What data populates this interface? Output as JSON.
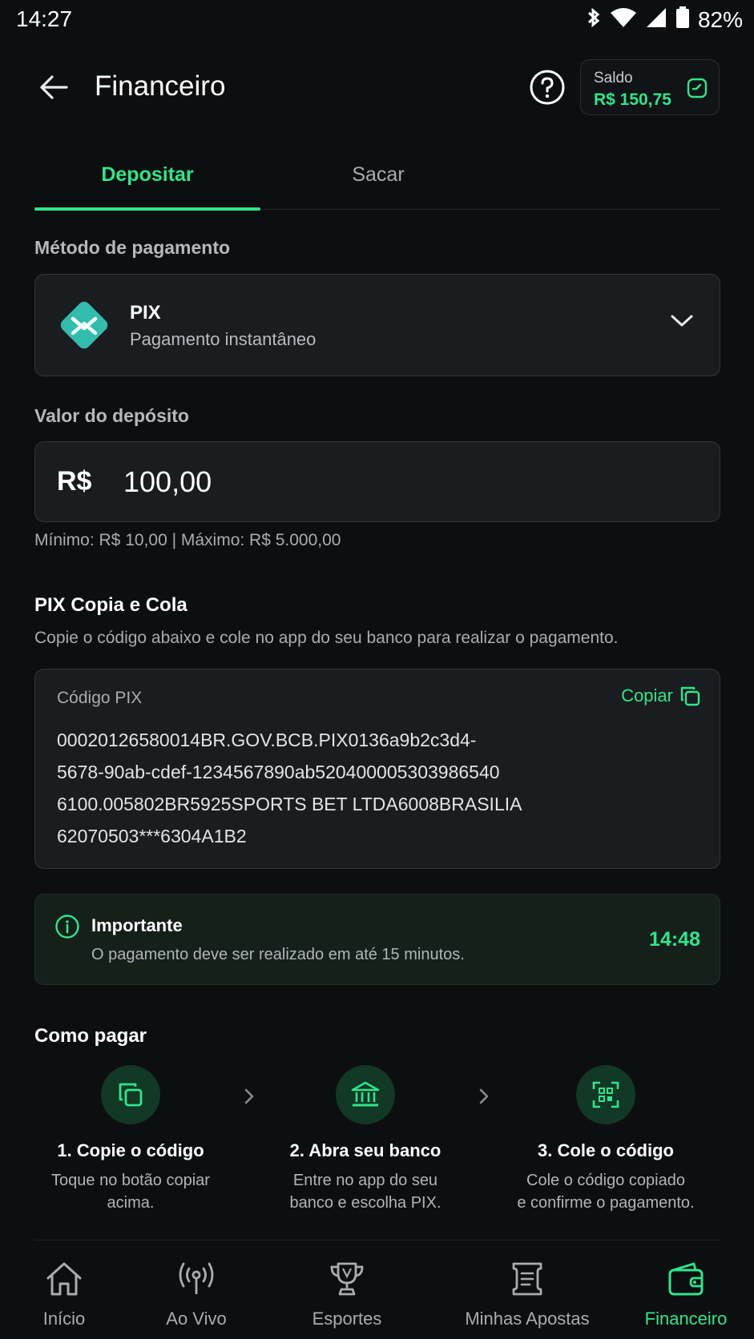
{
  "status_bar": {
    "time": "14:27",
    "battery": "82%"
  },
  "header": {
    "title": "Financeiro",
    "balance_label": "Saldo",
    "balance_value": "R$ 150,75"
  },
  "tabs": [
    {
      "label": "Depositar",
      "active": true
    },
    {
      "label": "Sacar",
      "active": false
    }
  ],
  "payment_method": {
    "section_label": "Método de pagamento",
    "name": "PIX",
    "description": "Pagamento instantâneo"
  },
  "deposit": {
    "section_label": "Valor do depósito",
    "currency": "R$",
    "value": "100,00",
    "limits": "Mínimo: R$ 10,00 | Máximo: R$ 5.000,00"
  },
  "pix_copy": {
    "title": "PIX Copia e Cola",
    "description": "Copie o código abaixo e cole no app do seu banco para realizar o pagamento.",
    "code_label": "Código PIX",
    "copy_label": "Copiar",
    "code_lines": [
      "00020126580014BR.GOV.BCB.PIX0136a9b2c3d4-",
      "5678-90ab-cdef-1234567890ab52040000530398654­0",
      "6100.005802BR5925SPORTS BET LTDA6008BRASILIA",
      "62070503***6304A1B2"
    ]
  },
  "notice": {
    "title": "Importante",
    "text": "O pagamento deve ser realizado em até 15 minutos.",
    "timer": "14:48"
  },
  "how_to_pay": {
    "title": "Como pagar",
    "steps": [
      {
        "icon": "copy-icon",
        "title": "1. Copie o código",
        "desc_1": "Toque no botão copiar",
        "desc_2": "acima."
      },
      {
        "icon": "bank-icon",
        "title": "2. Abra seu banco",
        "desc_1": "Entre no app do seu",
        "desc_2": "banco e escolha PIX."
      },
      {
        "icon": "qr-scan-icon",
        "title": "3. Cole o código",
        "desc_1": "Cole o código copiado",
        "desc_2": "e confirme o pagamento."
      }
    ]
  },
  "bottom_nav": [
    {
      "label": "Início",
      "icon": "home-icon",
      "active": false
    },
    {
      "label": "Ao Vivo",
      "icon": "live-broadcast-icon",
      "active": false
    },
    {
      "label": "Esportes",
      "icon": "trophy-icon",
      "active": false
    },
    {
      "label": "Minhas Apostas",
      "icon": "ticket-icon",
      "active": false
    },
    {
      "label": "Financeiro",
      "icon": "wallet-icon",
      "active": true
    }
  ],
  "colors": {
    "accent": "#2ee68a",
    "background": "#0d0e10",
    "card": "#1a1c1f",
    "pix": "#32bcad"
  }
}
